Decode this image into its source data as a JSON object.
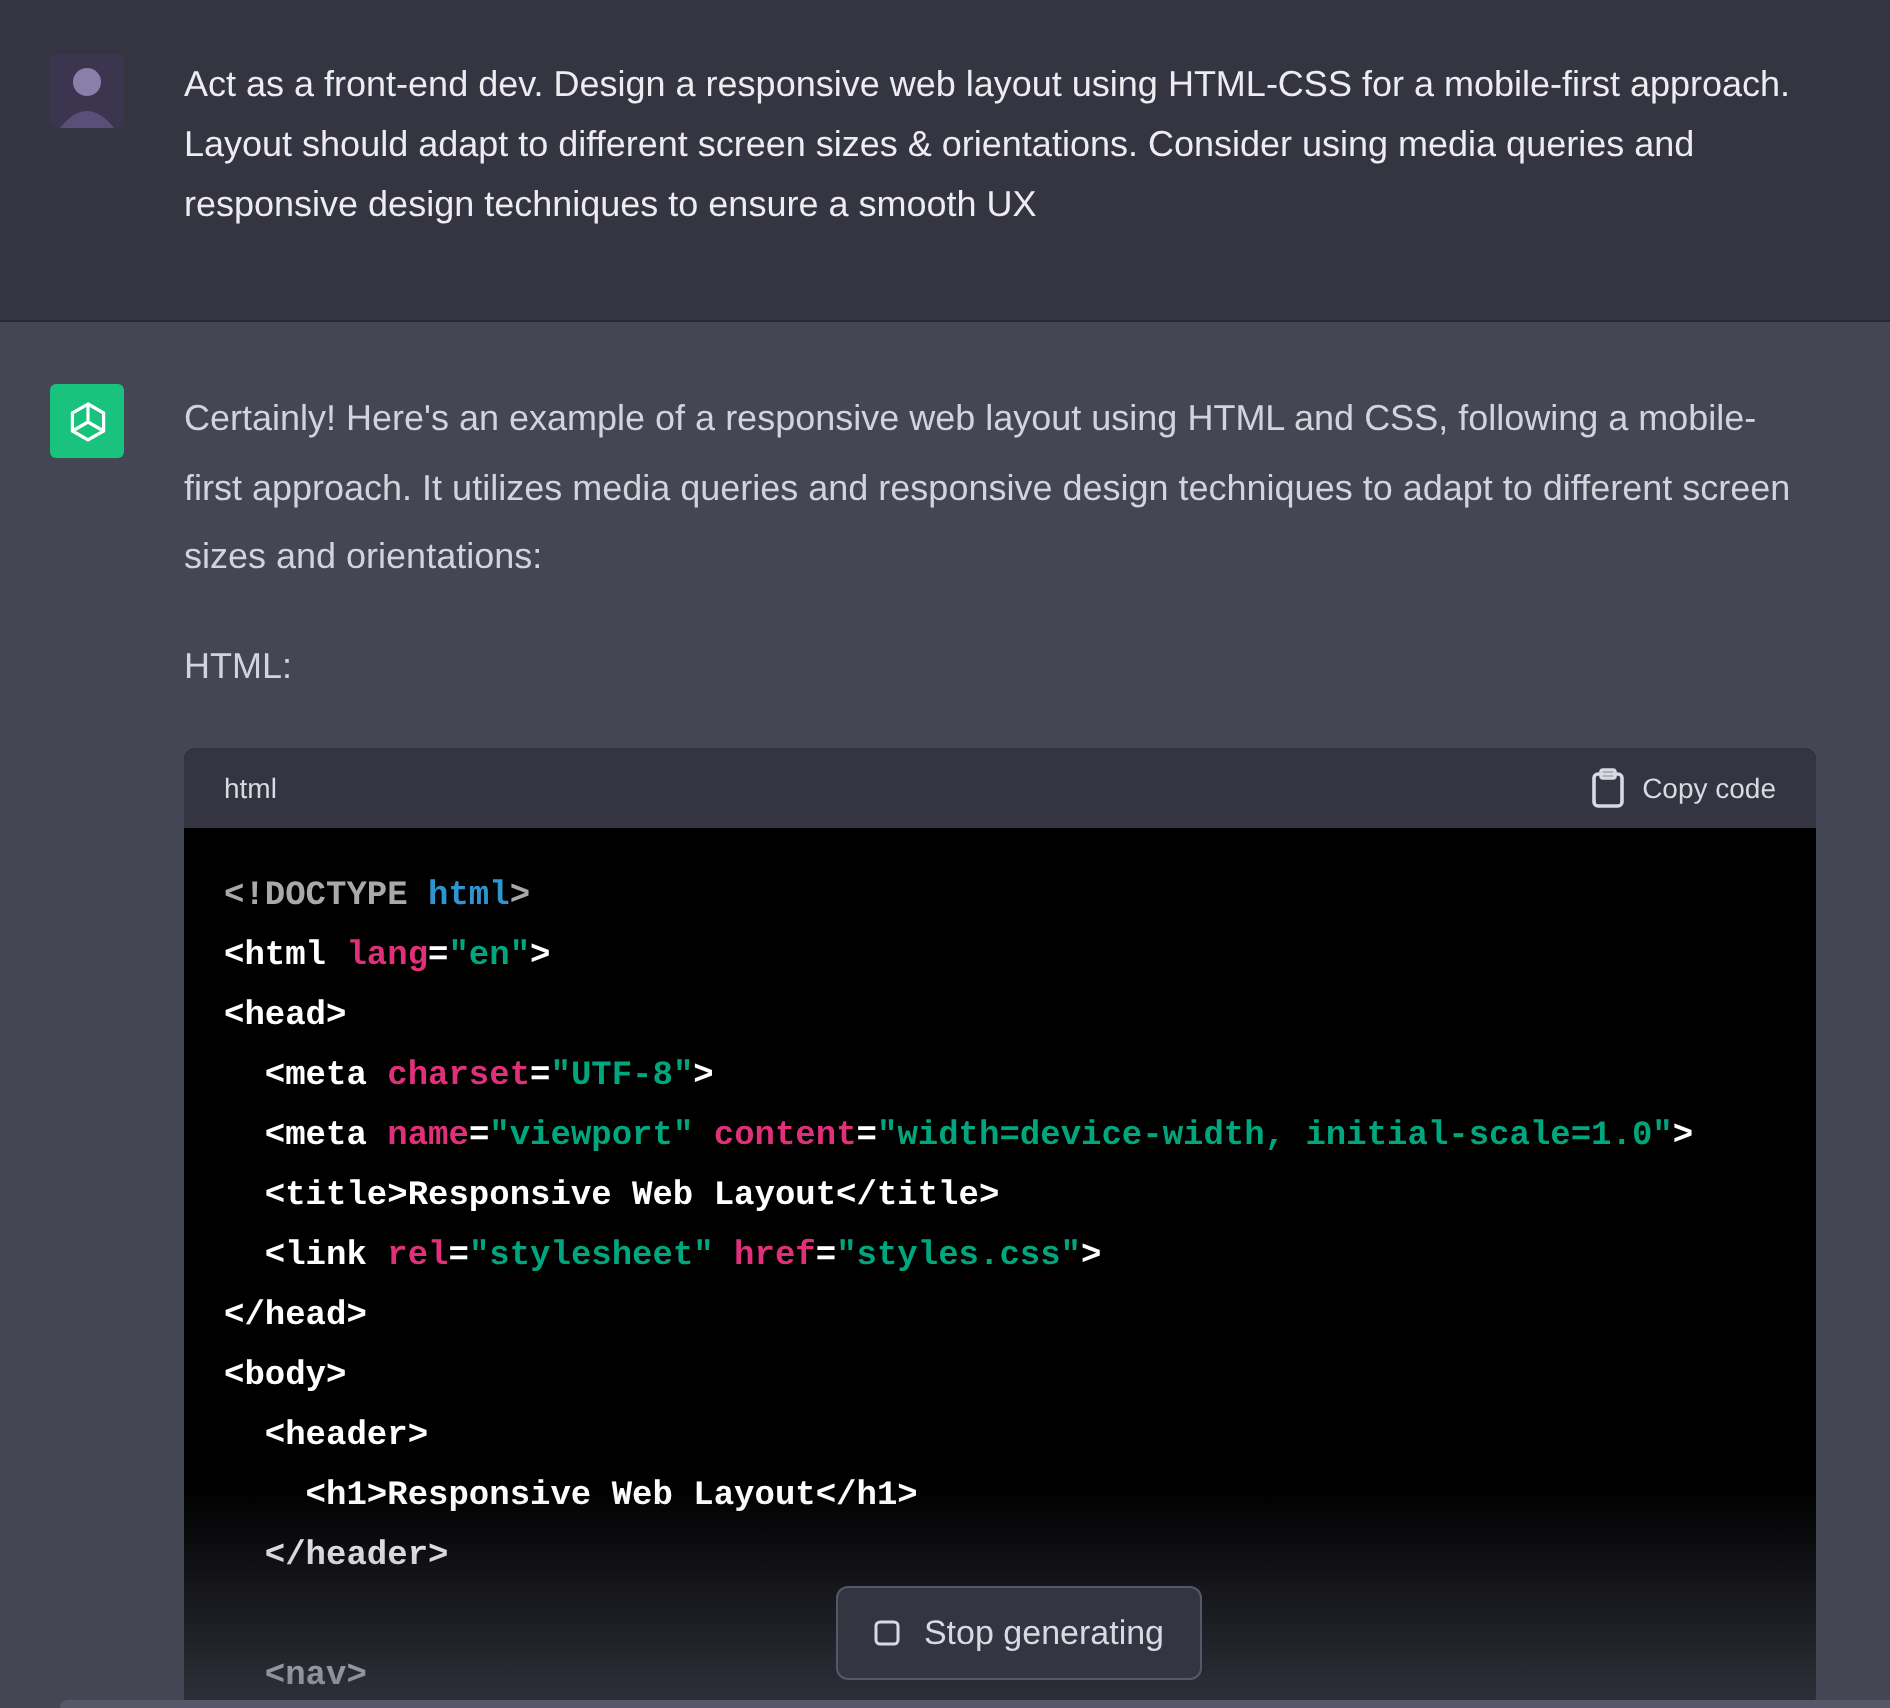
{
  "user_message": {
    "text": "Act as a front-end dev. Design a responsive web layout using HTML-CSS for a mobile-first approach. Layout should adapt to different screen sizes & orientations. Consider using media queries and responsive design techniques to ensure a smooth UX"
  },
  "assistant_message": {
    "paragraphs": [
      "Certainly! Here's an example of a responsive web layout using HTML and CSS, following a mobile-first approach. It utilizes media queries and responsive design techniques to adapt to different screen sizes and orientations:",
      "HTML:"
    ],
    "code_block": {
      "language": "html",
      "copy_label": "Copy code",
      "lines": [
        {
          "kind": "code",
          "tokens": [
            {
              "kind": "doctype",
              "text": "<!DOCTYPE "
            },
            {
              "kind": "keyword",
              "text": "html"
            },
            {
              "kind": "doctype",
              "text": ">"
            }
          ]
        },
        {
          "kind": "code",
          "tokens": [
            {
              "kind": "tag",
              "text": "<html "
            },
            {
              "kind": "attr",
              "text": "lang"
            },
            {
              "kind": "tag",
              "text": "="
            },
            {
              "kind": "string",
              "text": "\"en\""
            },
            {
              "kind": "tag",
              "text": ">"
            }
          ]
        },
        {
          "kind": "code",
          "tokens": [
            {
              "kind": "tag",
              "text": "<head>"
            }
          ]
        },
        {
          "kind": "code",
          "tokens": [
            {
              "kind": "tag",
              "text": "  <meta "
            },
            {
              "kind": "attr",
              "text": "charset"
            },
            {
              "kind": "tag",
              "text": "="
            },
            {
              "kind": "string",
              "text": "\"UTF-8\""
            },
            {
              "kind": "tag",
              "text": ">"
            }
          ]
        },
        {
          "kind": "code",
          "tokens": [
            {
              "kind": "tag",
              "text": "  <meta "
            },
            {
              "kind": "attr",
              "text": "name"
            },
            {
              "kind": "tag",
              "text": "="
            },
            {
              "kind": "string",
              "text": "\"viewport\""
            },
            {
              "kind": "attr",
              "text": " content"
            },
            {
              "kind": "tag",
              "text": "="
            },
            {
              "kind": "string",
              "text": "\"width=device-width, initial-scale=1.0\""
            },
            {
              "kind": "tag",
              "text": ">"
            }
          ]
        },
        {
          "kind": "code",
          "tokens": [
            {
              "kind": "tag",
              "text": "  <title>Responsive Web Layout</title>"
            }
          ]
        },
        {
          "kind": "code",
          "tokens": [
            {
              "kind": "tag",
              "text": "  <link "
            },
            {
              "kind": "attr",
              "text": "rel"
            },
            {
              "kind": "tag",
              "text": "="
            },
            {
              "kind": "string",
              "text": "\"stylesheet\""
            },
            {
              "kind": "attr",
              "text": " href"
            },
            {
              "kind": "tag",
              "text": "="
            },
            {
              "kind": "string",
              "text": "\"styles.css\""
            },
            {
              "kind": "tag",
              "text": ">"
            }
          ]
        },
        {
          "kind": "code",
          "tokens": [
            {
              "kind": "tag",
              "text": "</head>"
            }
          ]
        },
        {
          "kind": "code",
          "tokens": [
            {
              "kind": "tag",
              "text": "<body>"
            }
          ]
        },
        {
          "kind": "code",
          "tokens": [
            {
              "kind": "tag",
              "text": "  <header>"
            }
          ]
        },
        {
          "kind": "code",
          "tokens": [
            {
              "kind": "tag",
              "text": "    <h1>Responsive Web Layout</h1>"
            }
          ]
        },
        {
          "kind": "code",
          "tokens": [
            {
              "kind": "tag",
              "text": "  </header>"
            }
          ]
        },
        {
          "kind": "blank"
        },
        {
          "kind": "code",
          "tokens": [
            {
              "kind": "tag",
              "text": "  <nav>"
            }
          ]
        }
      ]
    }
  },
  "stop_button": {
    "label": "Stop generating"
  }
}
